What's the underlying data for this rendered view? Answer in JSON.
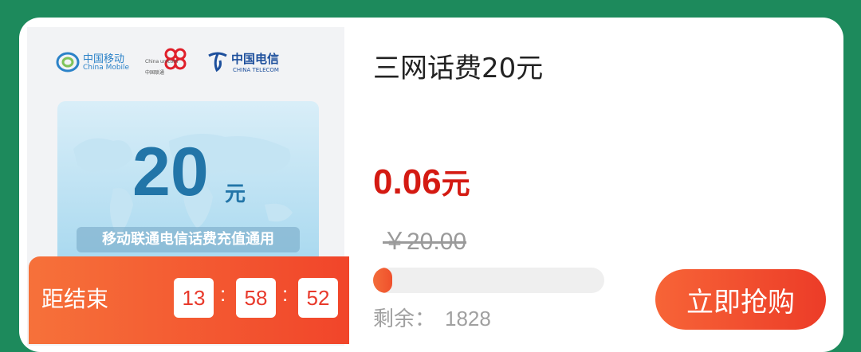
{
  "logos": {
    "china_mobile": {
      "cn": "中国移动",
      "en": "China Mobile",
      "icon": "china-mobile-logo"
    },
    "china_unicom": {
      "en": "China unicom",
      "cn": "中国联通",
      "icon": "china-unicom-logo"
    },
    "china_telecom": {
      "cn": "中国电信",
      "en": "CHINA TELECOM",
      "icon": "china-telecom-logo"
    }
  },
  "voucher": {
    "amount": "20",
    "unit": "元",
    "note": "移动联通电信话费充值通用"
  },
  "countdown": {
    "label": "距结束",
    "hours": "13",
    "minutes": "58",
    "seconds": "52",
    "separator": ":"
  },
  "product": {
    "title": "三网话费20元",
    "price": "0.06",
    "price_unit": "元",
    "original_price": "￥20.00",
    "progress_fraction": 0.08,
    "remaining_label": "剩余：",
    "remaining_value": "1828",
    "buy_label": "立即抢购"
  },
  "colors": {
    "background": "#1d8a5c",
    "price_red": "#d41a12",
    "accent_orange": "#f0502c"
  }
}
